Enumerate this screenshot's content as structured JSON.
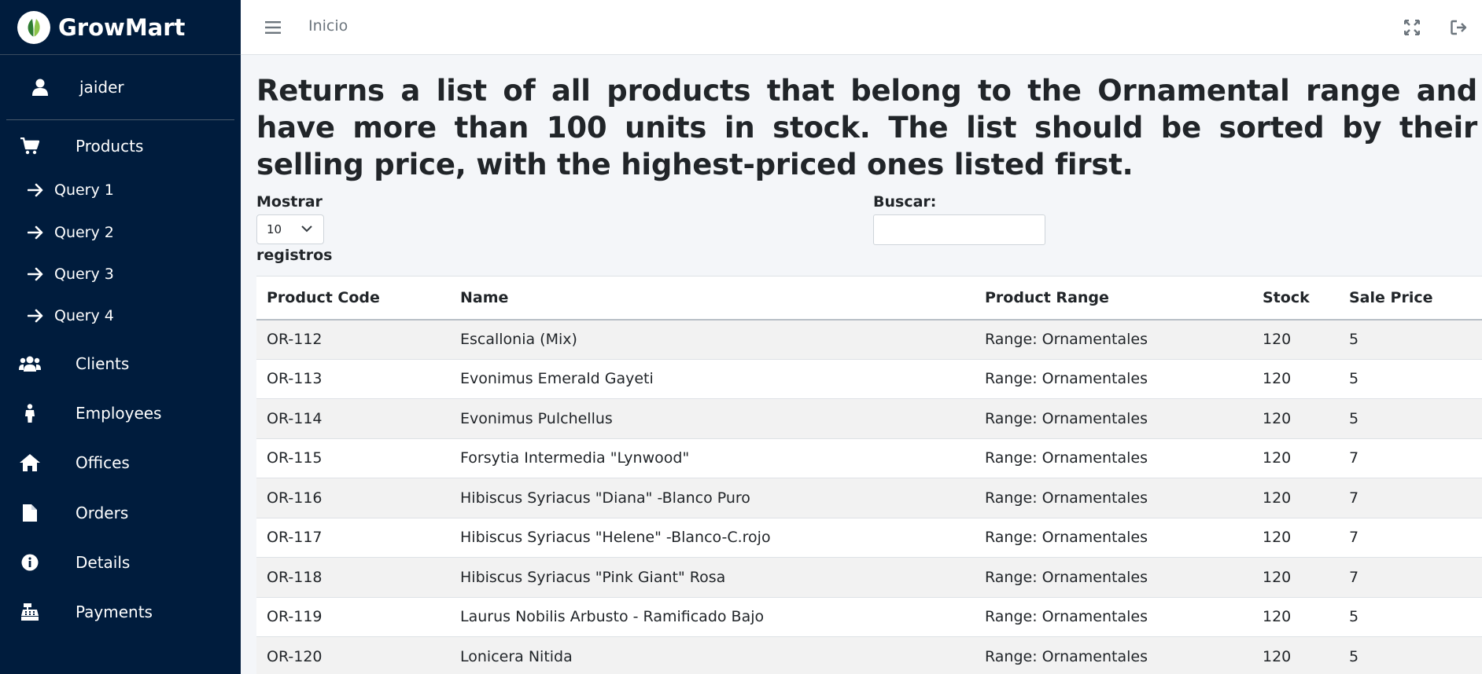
{
  "brand": {
    "name": "GrowMart",
    "accent": "#7cb342"
  },
  "user": {
    "name": "jaider"
  },
  "sidebar": {
    "items": [
      {
        "label": "Products",
        "icon": "cart-icon"
      },
      {
        "label": "Clients",
        "icon": "users-icon"
      },
      {
        "label": "Employees",
        "icon": "person-icon"
      },
      {
        "label": "Offices",
        "icon": "home-icon"
      },
      {
        "label": "Orders",
        "icon": "file-icon"
      },
      {
        "label": "Details",
        "icon": "info-icon"
      },
      {
        "label": "Payments",
        "icon": "cash-register-icon"
      }
    ],
    "subitems": [
      {
        "label": "Query 1",
        "icon": "arrow-right-icon"
      },
      {
        "label": "Query 2",
        "icon": "arrow-right-icon"
      },
      {
        "label": "Query 3",
        "icon": "arrow-right-icon"
      },
      {
        "label": "Query 4",
        "icon": "arrow-right-icon"
      }
    ],
    "bg_color": "#001c3d"
  },
  "topbar": {
    "home_label": "Inicio"
  },
  "main": {
    "title": "Returns a list of all products that belong to the Ornamental range and have more than 100 units in stock. The list should be sorted by their selling price, with the highest-priced ones listed first.",
    "length": {
      "label": "Mostrar",
      "value": "10",
      "suffix": "registros"
    },
    "search": {
      "label": "Buscar:",
      "value": ""
    }
  },
  "table": {
    "headers": [
      "Product Code",
      "Name",
      "Product Range",
      "Stock",
      "Sale Price"
    ],
    "rows": [
      [
        "OR-112",
        "Escallonia (Mix)",
        "Range: Ornamentales",
        "120",
        "5"
      ],
      [
        "OR-113",
        "Evonimus Emerald Gayeti",
        "Range: Ornamentales",
        "120",
        "5"
      ],
      [
        "OR-114",
        "Evonimus Pulchellus",
        "Range: Ornamentales",
        "120",
        "5"
      ],
      [
        "OR-115",
        "Forsytia Intermedia \"Lynwood\"",
        "Range: Ornamentales",
        "120",
        "7"
      ],
      [
        "OR-116",
        "Hibiscus Syriacus \"Diana\" -Blanco Puro",
        "Range: Ornamentales",
        "120",
        "7"
      ],
      [
        "OR-117",
        "Hibiscus Syriacus \"Helene\" -Blanco-C.rojo",
        "Range: Ornamentales",
        "120",
        "7"
      ],
      [
        "OR-118",
        "Hibiscus Syriacus \"Pink Giant\" Rosa",
        "Range: Ornamentales",
        "120",
        "7"
      ],
      [
        "OR-119",
        "Laurus Nobilis Arbusto - Ramificado Bajo",
        "Range: Ornamentales",
        "120",
        "5"
      ],
      [
        "OR-120",
        "Lonicera Nitida",
        "Range: Ornamentales",
        "120",
        "5"
      ]
    ]
  }
}
